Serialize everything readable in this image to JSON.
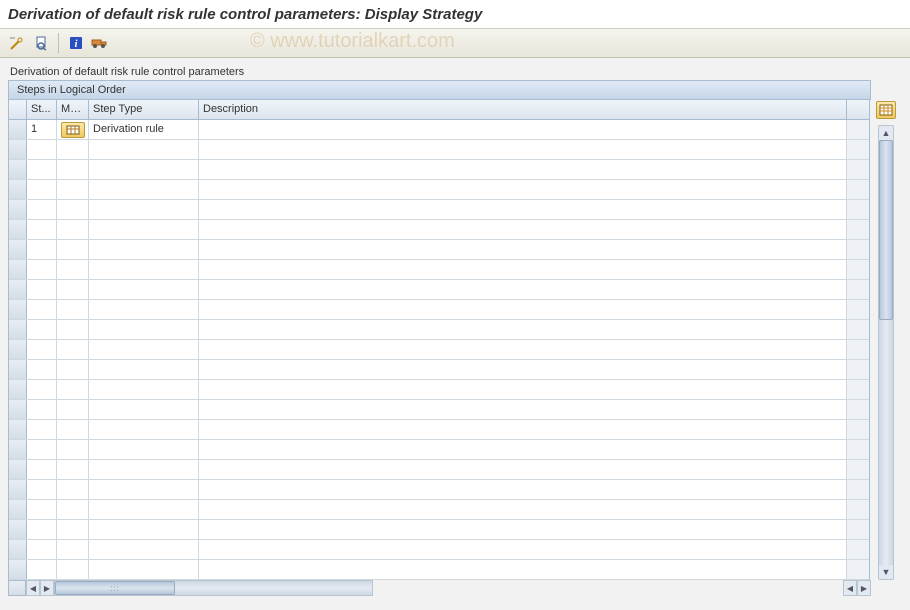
{
  "title": "Derivation of default risk rule control parameters: Display Strategy",
  "watermark": "© www.tutorialkart.com",
  "toolbar": {
    "btn1": "change-display-icon",
    "btn2": "overview-icon",
    "btn3": "info-icon",
    "btn4": "transport-icon"
  },
  "section_header": "Derivation of default risk rule control parameters",
  "panel_title": "Steps in Logical Order",
  "columns": {
    "st": "St...",
    "ma": "Ma...",
    "type": "Step Type",
    "desc": "Description"
  },
  "rows": [
    {
      "st": "1",
      "type": "Derivation rule",
      "desc": ""
    }
  ],
  "empty_row_count": 22
}
